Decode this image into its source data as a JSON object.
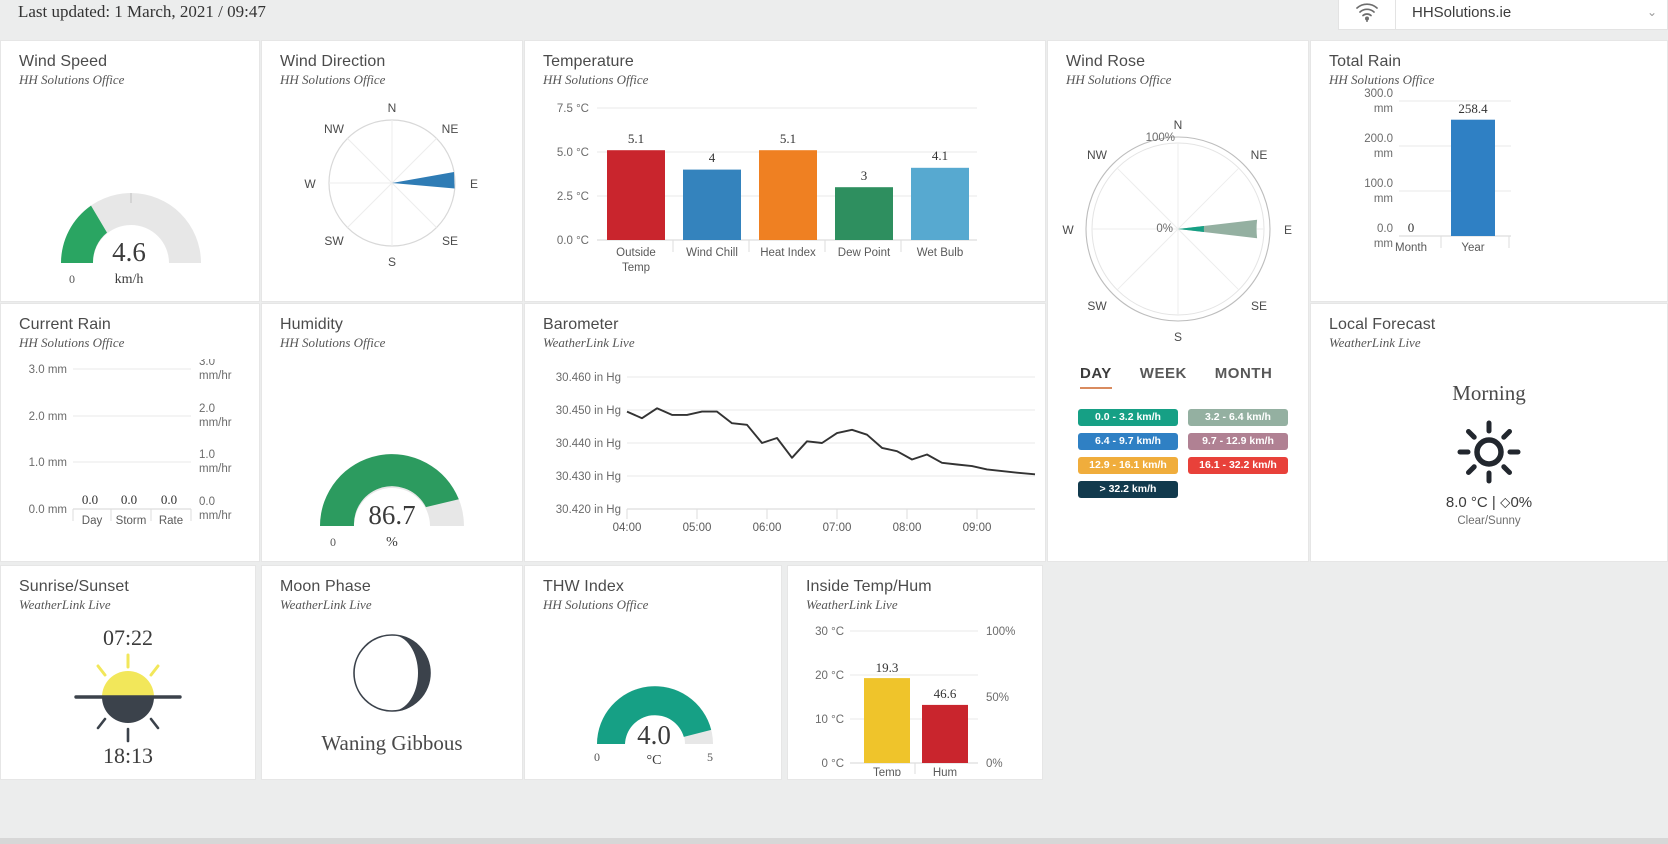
{
  "header": {
    "last_updated": "Last updated: 1 March, 2021 / 09:47",
    "site_name": "HHSolutions.ie",
    "wifi_icon": "wifi-icon",
    "caret_icon": "chevron-down-icon"
  },
  "sources": {
    "office": "HH Solutions Office",
    "wll": "WeatherLink Live"
  },
  "cards": {
    "wind_speed": {
      "title": "Wind Speed",
      "source": "HH Solutions Office",
      "value": "4.6",
      "unit": "km/h",
      "min_label": "0",
      "color": "#2aa562",
      "track_color": "#e7e7e7",
      "fill_fraction": 0.25
    },
    "wind_direction": {
      "title": "Wind Direction",
      "source": "HH Solutions Office",
      "compass": [
        "N",
        "NE",
        "E",
        "SE",
        "S",
        "SW",
        "W",
        "NW"
      ],
      "direction_deg": 92,
      "spread_deg": 13,
      "color": "#2f7cb5"
    },
    "temperature": {
      "title": "Temperature",
      "source": "HH Solutions Office",
      "y_ticks": [
        "7.5 °C",
        "5.0 °C",
        "2.5 °C",
        "0.0 °C"
      ]
    },
    "wind_rose": {
      "title": "Wind Rose",
      "source": "HH Solutions Office",
      "compass": [
        "N",
        "NE",
        "E",
        "SE",
        "S",
        "SW",
        "W",
        "NW"
      ],
      "radial_labels": [
        "100%",
        "0%"
      ],
      "tabs": [
        {
          "label": "DAY",
          "active": true
        },
        {
          "label": "WEEK",
          "active": false
        },
        {
          "label": "MONTH",
          "active": false
        }
      ],
      "legend": [
        {
          "label": "0.0 - 3.2 km/h",
          "color": "#16a085"
        },
        {
          "label": "3.2 - 6.4 km/h",
          "color": "#94b0a1"
        },
        {
          "label": "6.4 - 9.7 km/h",
          "color": "#2f80c4"
        },
        {
          "label": "9.7 - 12.9 km/h",
          "color": "#b08193"
        },
        {
          "label": "12.9 - 16.1 km/h",
          "color": "#f0ad3c"
        },
        {
          "label": "16.1 - 32.2 km/h",
          "color": "#e8413a"
        },
        {
          "label": "> 32.2 km/h",
          "color": "#123a4d"
        }
      ],
      "petals": [
        {
          "color": "#16a085",
          "fraction": 0.3
        },
        {
          "color": "#94b0a1",
          "fraction": 0.92
        }
      ],
      "accent": "#d98b5f"
    },
    "total_rain": {
      "title": "Total Rain",
      "source": "HH Solutions Office",
      "y_ticks": [
        "300.0 mm",
        "200.0 mm",
        "100.0 mm",
        "0.0 mm"
      ]
    },
    "current_rain": {
      "title": "Current Rain",
      "source": "HH Solutions Office",
      "y_ticks_left": [
        "3.0 mm",
        "2.0 mm",
        "1.0 mm",
        "0.0 mm"
      ],
      "y_ticks_right": [
        "3.0 mm/hr",
        "2.0 mm/hr",
        "1.0 mm/hr",
        "0.0 mm/hr"
      ],
      "categories": [
        "Day",
        "Storm",
        "Rate"
      ],
      "values": [
        "0.0",
        "0.0",
        "0.0"
      ]
    },
    "humidity": {
      "title": "Humidity",
      "source": "HH Solutions Office",
      "value": "86.7",
      "unit": "%",
      "min_label": "0",
      "color": "#2c9b5f",
      "track_color": "#e7e7e7",
      "fill_fraction": 0.867
    },
    "barometer": {
      "title": "Barometer",
      "source": "WeatherLink Live",
      "y_ticks": [
        "30.460 in Hg",
        "30.450 in Hg",
        "30.440 in Hg",
        "30.430 in Hg",
        "30.420 in Hg"
      ],
      "x_ticks": [
        "04:00",
        "05:00",
        "06:00",
        "07:00",
        "08:00",
        "09:00"
      ],
      "line_color": "#333333"
    },
    "local_forecast": {
      "title": "Local Forecast",
      "source": "WeatherLink Live",
      "period": "Morning",
      "icon": "sun-icon",
      "temp_precip": "8.0 °C | ⬦0%",
      "description": "Clear/Sunny"
    },
    "sunrise_sunset": {
      "title": "Sunrise/Sunset",
      "source": "WeatherLink Live",
      "sunrise": "07:22",
      "sunset": "18:13",
      "icon": "sunrise-sunset-icon",
      "sun_color": "#f2e75a",
      "shadow_color": "#3b424b"
    },
    "moon_phase": {
      "title": "Moon Phase",
      "source": "WeatherLink Live",
      "phase": "Waning Gibbous",
      "icon": "moon-icon"
    },
    "thw_index": {
      "title": "THW Index",
      "source": "HH Solutions Office",
      "value": "4.0",
      "unit": "°C",
      "min_label": "0",
      "max_label": "5",
      "color": "#16a085",
      "track_color": "#e7e7e7",
      "fill_fraction": 0.8
    },
    "inside_temp_hum": {
      "title": "Inside Temp/Hum",
      "source": "WeatherLink Live",
      "y_ticks_left": [
        "30 °C",
        "20 °C",
        "10 °C",
        "0 °C"
      ],
      "y_ticks_right": [
        "100%",
        "50%",
        "0%"
      ]
    }
  },
  "chart_data": [
    {
      "type": "bar",
      "name": "temperature",
      "title": "Temperature",
      "categories": [
        "Outside Temp",
        "Wind Chill",
        "Heat Index",
        "Dew Point",
        "Wet Bulb"
      ],
      "values": [
        5.1,
        4.0,
        5.1,
        3.0,
        4.1
      ],
      "colors": [
        "#c9252d",
        "#3483bd",
        "#ef8022",
        "#2e8f5f",
        "#57a9d0"
      ],
      "ylabel": "°C",
      "ylim": [
        0,
        7.5
      ],
      "yticks": [
        0.0,
        2.5,
        5.0,
        7.5
      ],
      "ytick_labels": [
        "0.0 °C",
        "2.5 °C",
        "5.0 °C",
        "7.5 °C"
      ],
      "grid": true,
      "legend": "none"
    },
    {
      "type": "bar",
      "name": "total_rain",
      "title": "Total Rain",
      "categories": [
        "Month",
        "Year"
      ],
      "values": [
        0.0,
        258.4
      ],
      "colors": [
        "#2f80c4",
        "#2f80c4"
      ],
      "ylabel": "mm",
      "ylim": [
        0,
        300
      ],
      "yticks": [
        0,
        100,
        200,
        300
      ],
      "ytick_labels": [
        "0.0 mm",
        "100.0 mm",
        "200.0 mm",
        "300.0 mm"
      ],
      "grid": true,
      "legend": "none"
    },
    {
      "type": "bar",
      "name": "current_rain",
      "title": "Current Rain",
      "categories": [
        "Day",
        "Storm",
        "Rate"
      ],
      "values": [
        0.0,
        0.0,
        0.0
      ],
      "ylabel": "mm",
      "ylim": [
        0,
        3
      ],
      "yticks": [
        0,
        1,
        2,
        3
      ],
      "ytick_labels": [
        "0.0 mm",
        "1.0 mm",
        "2.0 mm",
        "3.0 mm"
      ],
      "y2tick_labels": [
        "0.0 mm/hr",
        "1.0 mm/hr",
        "2.0 mm/hr",
        "3.0 mm/hr"
      ],
      "grid": true,
      "legend": "none"
    },
    {
      "type": "line",
      "name": "barometer",
      "title": "Barometer",
      "x": [
        "04:00",
        "04:12",
        "04:24",
        "04:36",
        "04:48",
        "05:00",
        "05:12",
        "05:24",
        "05:36",
        "05:48",
        "06:00",
        "06:12",
        "06:24",
        "06:36",
        "06:48",
        "07:00",
        "07:12",
        "07:24",
        "07:36",
        "07:48",
        "08:00",
        "08:12",
        "08:24",
        "08:36",
        "08:48",
        "09:00",
        "09:12",
        "09:24"
      ],
      "values": [
        30.4495,
        30.4475,
        30.4505,
        30.4485,
        30.4485,
        30.4495,
        30.4495,
        30.446,
        30.4455,
        30.44,
        30.4415,
        30.4355,
        30.4405,
        30.44,
        30.443,
        30.444,
        30.4425,
        30.4385,
        30.4375,
        30.435,
        30.4365,
        30.434,
        30.4335,
        30.433,
        30.432,
        30.4315,
        30.431,
        30.4305
      ],
      "xlabel": "",
      "ylabel": "in Hg",
      "ylim": [
        30.42,
        30.46
      ],
      "yticks": [
        30.42,
        30.43,
        30.44,
        30.45,
        30.46
      ],
      "ytick_labels": [
        "30.420 in Hg",
        "30.430 in Hg",
        "30.440 in Hg",
        "30.450 in Hg",
        "30.460 in Hg"
      ],
      "xtick_labels": [
        "04:00",
        "05:00",
        "06:00",
        "07:00",
        "08:00",
        "09:00"
      ],
      "grid": true,
      "legend": "none"
    },
    {
      "type": "bar",
      "name": "inside_temp_hum",
      "title": "Inside Temp/Hum",
      "categories": [
        "Temp",
        "Hum"
      ],
      "values": [
        19.3,
        46.6
      ],
      "colors": [
        "#efc42b",
        "#c9252d"
      ],
      "ylabel": "°C",
      "ylim": [
        0,
        30
      ],
      "yticks": [
        0,
        10,
        20,
        30
      ],
      "ytick_labels": [
        "0 °C",
        "10 °C",
        "20 °C",
        "30 °C"
      ],
      "y2tick_labels": [
        "0%",
        "50%",
        "100%"
      ],
      "y2lim": [
        0,
        100
      ],
      "grid": true,
      "legend": "none"
    },
    {
      "type": "pie",
      "name": "wind_direction",
      "title": "Wind Direction",
      "categories": [
        "N",
        "NE",
        "E",
        "SE",
        "S",
        "SW",
        "W",
        "NW"
      ],
      "direction_deg": 92,
      "values": [
        0,
        0,
        100,
        0,
        0,
        0,
        0,
        0
      ],
      "legend": "none"
    },
    {
      "type": "pie",
      "name": "wind_rose",
      "title": "Wind Rose",
      "categories": [
        "0.0 - 3.2 km/h",
        "3.2 - 6.4 km/h",
        "6.4 - 9.7 km/h",
        "9.7 - 12.9 km/h",
        "12.9 - 16.1 km/h",
        "16.1 - 32.2 km/h",
        "> 32.2 km/h"
      ],
      "values": [
        30,
        92,
        0,
        0,
        0,
        0,
        0
      ],
      "direction_deg": 90,
      "radial_ticks": [
        "0%",
        "100%"
      ],
      "legend": "bottom"
    }
  ]
}
